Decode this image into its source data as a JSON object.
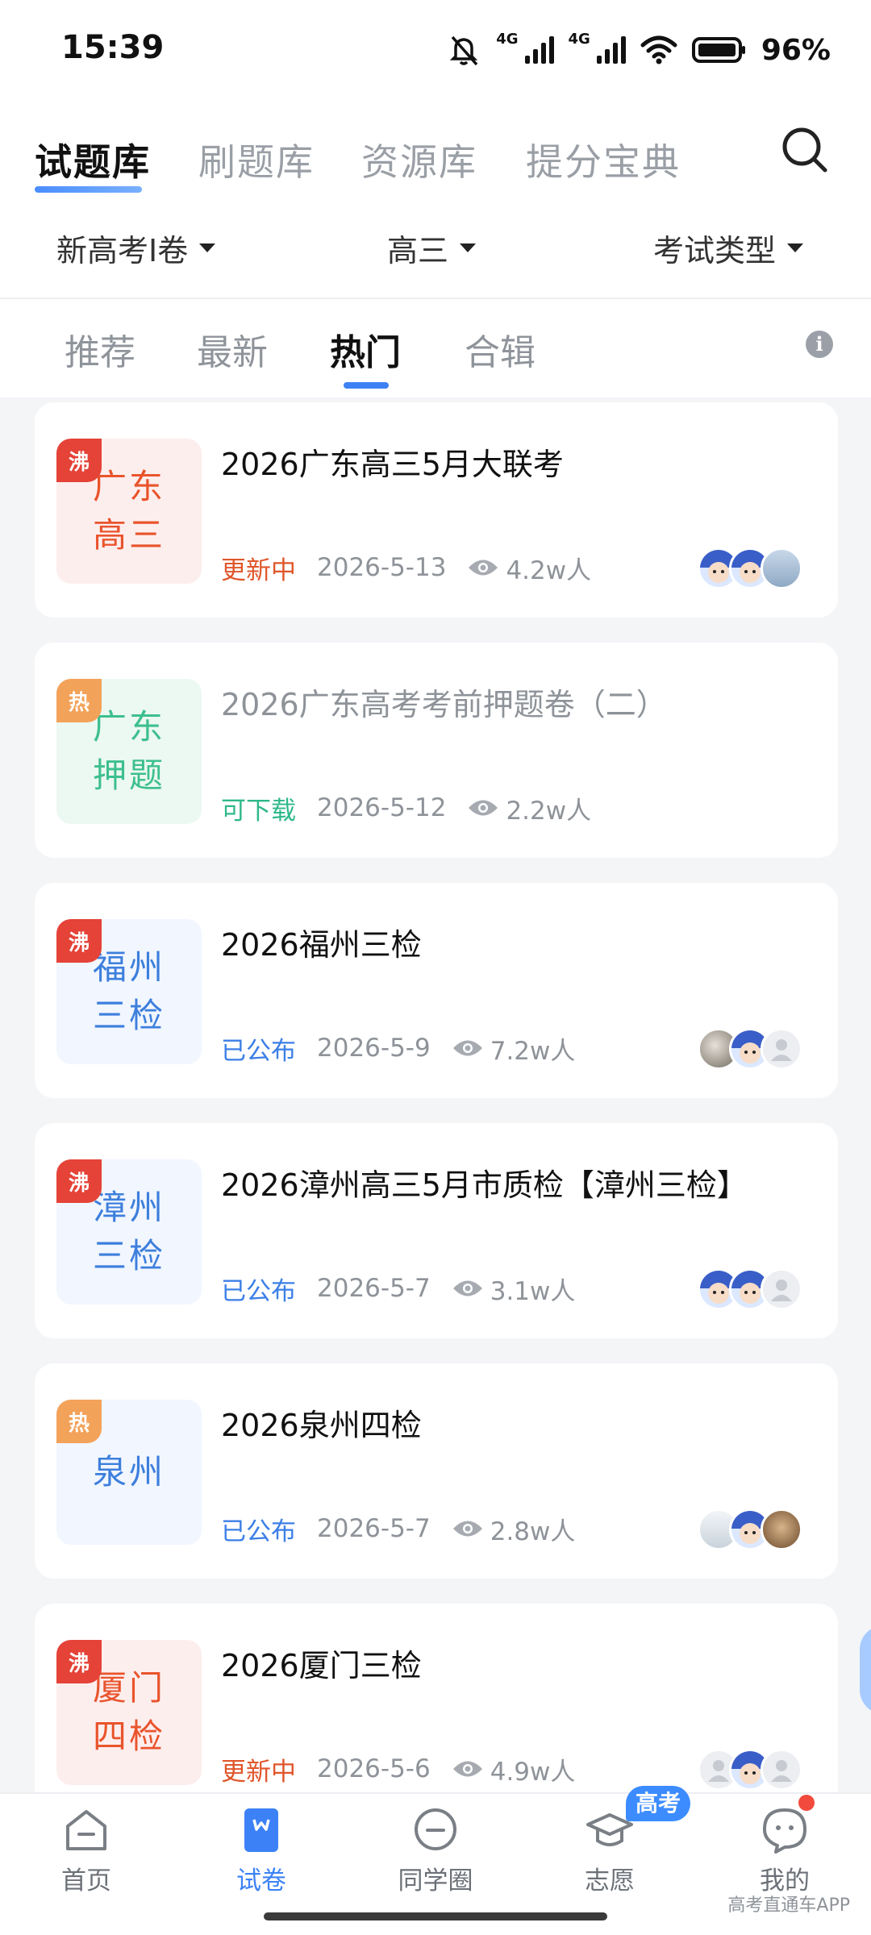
{
  "status_bar": {
    "time": "15:39",
    "network_1": "4G",
    "network_2": "4G",
    "battery": "96%"
  },
  "top_tabs": [
    "试题库",
    "刷题库",
    "资源库",
    "提分宝典"
  ],
  "filters": {
    "exam_paper": "新高考Ⅰ卷",
    "grade": "高三",
    "exam_type": "考试类型"
  },
  "sub_tabs": [
    "推荐",
    "最新",
    "热门",
    "合辑"
  ],
  "cards": [
    {
      "badge": "沸",
      "thumb_line1": "广东",
      "thumb_line2": "高三",
      "title": "2026广东高三5月大联考",
      "status": "更新中",
      "date": "2026-5-13",
      "views": "4.2w人",
      "status_color": "#e0562b",
      "thumb_color": "#e9542c"
    },
    {
      "badge": "热",
      "thumb_line1": "广东",
      "thumb_line2": "押题",
      "title": "2026广东高考考前押题卷（二）",
      "status": "可下载",
      "date": "2026-5-12",
      "views": "2.2w人",
      "status_color": "#2fb88a",
      "thumb_color": "#3dbf8f"
    },
    {
      "badge": "沸",
      "thumb_line1": "福州",
      "thumb_line2": "三检",
      "title": "2026福州三检",
      "status": "已公布",
      "date": "2026-5-9",
      "views": "7.2w人",
      "status_color": "#3c7fe6",
      "thumb_color": "#3d7fdc"
    },
    {
      "badge": "沸",
      "thumb_line1": "漳州",
      "thumb_line2": "三检",
      "title": "2026漳州高三5月市质检【漳州三检】",
      "status": "已公布",
      "date": "2026-5-7",
      "views": "3.1w人",
      "status_color": "#3c7fe6",
      "thumb_color": "#3d7fdc"
    },
    {
      "badge": "热",
      "thumb_line1": "泉州",
      "thumb_line2": "",
      "title": "2026泉州四检",
      "status": "已公布",
      "date": "2026-5-7",
      "views": "2.8w人",
      "status_color": "#3c7fe6",
      "thumb_color": "#3d7fdc"
    },
    {
      "badge": "沸",
      "thumb_line1": "厦门",
      "thumb_line2": "四检",
      "title": "2026厦门三检",
      "status": "更新中",
      "date": "2026-5-6",
      "views": "4.9w人",
      "status_color": "#e0562b",
      "thumb_color": "#e9542c"
    }
  ],
  "bottom_nav": {
    "items": [
      "首页",
      "试卷",
      "同学圈",
      "志愿",
      "我的"
    ],
    "volunteer_badge": "高考",
    "watermark": "高考直通车APP"
  }
}
